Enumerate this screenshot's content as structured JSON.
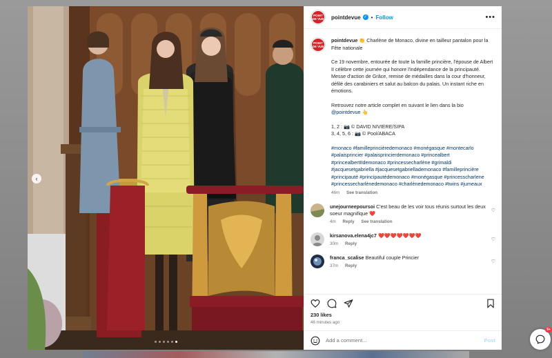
{
  "header": {
    "username": "pointdevue",
    "separator": "•",
    "follow_label": "Follow",
    "more_icon": "more-horizontal-icon"
  },
  "brand": {
    "logo_text_top": "POINT",
    "logo_text_bottom": "DE VUE",
    "color": "#d6232a"
  },
  "caption": {
    "username": "pointdevue",
    "title": "👏 Charlène de Monaco, divine en tailleur pantalon pour la Fête nationale",
    "paragraph1": "Ce 19 novembre, entourée de toute la famille princière, l'épouse de Albert II célèbre cette journée qui honore l'indépendance de la principauté. Messe d'action de Grâce, remise de médailles dans la cour d'honneur, défilé des carabiniers et salut au balcon du palais. Un instant riche en émotions.",
    "paragraph2": "Retrouvez notre article complet en suivant le lien dans la bio",
    "mention": "@pointdevue",
    "mention_emoji": "👆",
    "credit1": "1, 2 : 📷 © DAVID NIVIERE/SIPA",
    "credit2": "3, 4, 5, 6 : 📷 © Pool/ABACA",
    "hashtags": "#monaco #familleprincièredemonaco #monégasque #montecarlo #palaisprincier #palaisprincierdemonaco #princealbert #princealbertIIdemonaco #princessecharlène #grimaldi #jacquesetgabriella #jacquesetgabriellademonaco #familleprincière #principauté #principautédemonaco #monégasque #princesscharlene #princessecharlènedemonaco #charlènedemonaco #twins #jumeaux",
    "time": "46m",
    "see_translation": "See translation"
  },
  "comments": [
    {
      "username": "unejourneepoursoi",
      "text": "C'est beau de les voir tous réunis surtout les deux soeur magnifique ❤️",
      "time": "4m",
      "reply": "Reply",
      "see_translation": "See translation"
    },
    {
      "username": "kirsanova.elena4jc7",
      "text": "❤️❤️❤️❤️❤️❤️❤️",
      "time": "30m",
      "reply": "Reply"
    },
    {
      "username": "franca_scalise",
      "text": "Beautiful couple Princier",
      "time": "37m",
      "reply": "Reply"
    }
  ],
  "stats": {
    "likes": "230 likes",
    "posted": "46 minutes ago"
  },
  "composer": {
    "placeholder": "Add a comment...",
    "post_label": "Post"
  },
  "notification": {
    "badge": "9+"
  },
  "media": {
    "dots_total": 6,
    "active_dot": 6,
    "prev_arrow": "‹"
  },
  "colors": {
    "link": "#00376b",
    "follow": "#0095f6",
    "muted": "#737373",
    "post_disabled": "#b2dffc"
  }
}
